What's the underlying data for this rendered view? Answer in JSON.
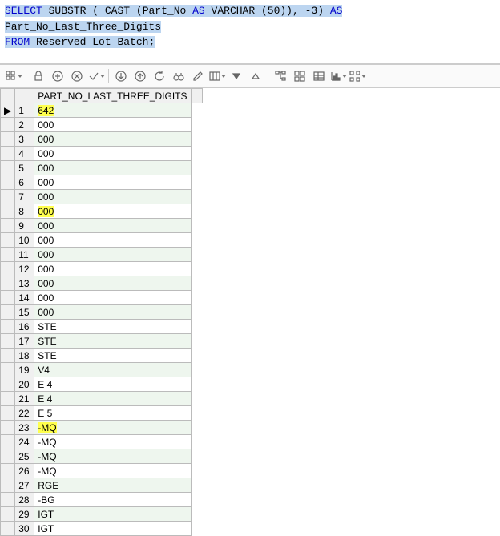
{
  "sql": {
    "line1_a": "SELECT",
    "line1_b": "SUBSTR",
    "line1_c": "(",
    "line1_d": "CAST",
    "line1_e": "(Part_No ",
    "line1_f": "AS",
    "line1_g": " VARCHAR",
    "line1_h": "(50)),",
    "line1_i": " -3) ",
    "line1_j": "AS",
    "line1_k": " Part_No_Last_Three_Digits",
    "line2_a": "FROM",
    "line2_b": " Reserved_Lot_Batch;"
  },
  "grid": {
    "header": "PART_NO_LAST_THREE_DIGITS",
    "rows": [
      {
        "n": "1",
        "v": "642",
        "hl": true,
        "ind": "▶"
      },
      {
        "n": "2",
        "v": "000"
      },
      {
        "n": "3",
        "v": "000"
      },
      {
        "n": "4",
        "v": "000"
      },
      {
        "n": "5",
        "v": "000"
      },
      {
        "n": "6",
        "v": "000"
      },
      {
        "n": "7",
        "v": "000"
      },
      {
        "n": "8",
        "v": "000",
        "hl": true
      },
      {
        "n": "9",
        "v": "000"
      },
      {
        "n": "10",
        "v": "000"
      },
      {
        "n": "11",
        "v": "000"
      },
      {
        "n": "12",
        "v": "000"
      },
      {
        "n": "13",
        "v": "000"
      },
      {
        "n": "14",
        "v": "000"
      },
      {
        "n": "15",
        "v": "000"
      },
      {
        "n": "16",
        "v": "STE"
      },
      {
        "n": "17",
        "v": "STE"
      },
      {
        "n": "18",
        "v": "STE"
      },
      {
        "n": "19",
        "v": " V4"
      },
      {
        "n": "20",
        "v": "E 4"
      },
      {
        "n": "21",
        "v": "E 4"
      },
      {
        "n": "22",
        "v": "E 5"
      },
      {
        "n": "23",
        "v": "-MQ",
        "hl": true
      },
      {
        "n": "24",
        "v": "-MQ"
      },
      {
        "n": "25",
        "v": "-MQ"
      },
      {
        "n": "26",
        "v": "-MQ"
      },
      {
        "n": "27",
        "v": "RGE"
      },
      {
        "n": "28",
        "v": "-BG"
      },
      {
        "n": "29",
        "v": "IGT"
      },
      {
        "n": "30",
        "v": "IGT"
      }
    ]
  }
}
